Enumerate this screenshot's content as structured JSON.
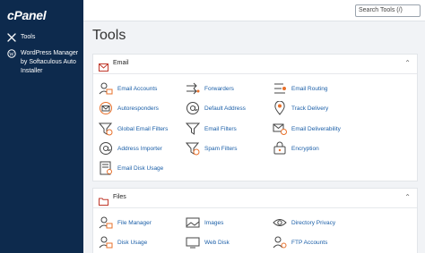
{
  "sidebar": {
    "logo": "cPanel",
    "items": [
      {
        "label": "Tools",
        "icon": "tools-icon"
      },
      {
        "label": "WordPress Manager by Softaculous Auto Installer",
        "icon": "wordpress-icon"
      }
    ]
  },
  "topbar": {
    "search_placeholder": "Search Tools (/)"
  },
  "page": {
    "title": "Tools"
  },
  "email_section": {
    "title": "Email",
    "items": [
      {
        "label": "Email Accounts",
        "icon": "email-accounts-icon"
      },
      {
        "label": "Forwarders",
        "icon": "forwarders-icon"
      },
      {
        "label": "Email Routing",
        "icon": "email-routing-icon"
      },
      {
        "label": "Autoresponders",
        "icon": "autoresponders-icon"
      },
      {
        "label": "Default Address",
        "icon": "default-address-icon"
      },
      {
        "label": "Track Delivery",
        "icon": "track-delivery-icon"
      },
      {
        "label": "Global Email Filters",
        "icon": "global-email-filters-icon"
      },
      {
        "label": "Email Filters",
        "icon": "email-filters-icon"
      },
      {
        "label": "Email Deliverability",
        "icon": "email-deliverability-icon"
      },
      {
        "label": "Address Importer",
        "icon": "address-importer-icon"
      },
      {
        "label": "Spam Filters",
        "icon": "spam-filters-icon"
      },
      {
        "label": "Encryption",
        "icon": "encryption-icon"
      },
      {
        "label": "Email Disk Usage",
        "icon": "email-disk-usage-icon"
      }
    ]
  },
  "files_section": {
    "title": "Files",
    "items": [
      {
        "label": "File Manager",
        "icon": "file-manager-icon"
      },
      {
        "label": "Images",
        "icon": "images-icon"
      },
      {
        "label": "Directory Privacy",
        "icon": "directory-privacy-icon"
      },
      {
        "label": "Disk Usage",
        "icon": "disk-usage-icon"
      },
      {
        "label": "Web Disk",
        "icon": "web-disk-icon"
      },
      {
        "label": "FTP Accounts",
        "icon": "ftp-accounts-icon"
      }
    ]
  },
  "colors": {
    "sidebar": "#0d2a4d",
    "link": "#1b5fa8",
    "accent_orange": "#e8702a"
  }
}
